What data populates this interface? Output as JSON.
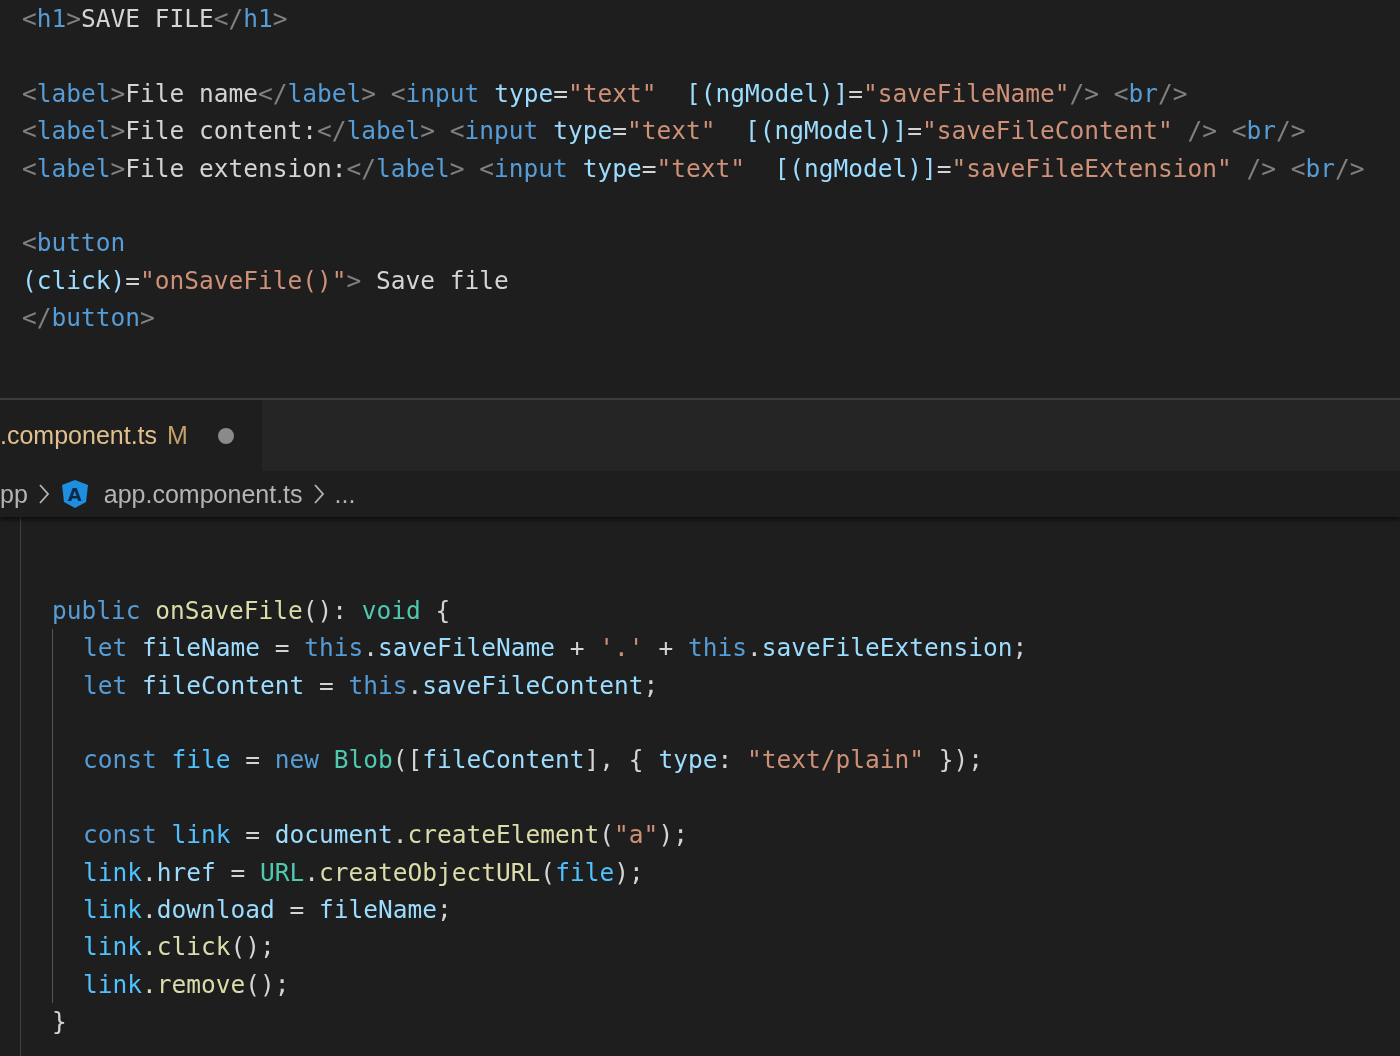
{
  "top_editor": {
    "lines": [
      {
        "kind": "code",
        "tokens": [
          {
            "kind": "bracket",
            "text": "<"
          },
          {
            "kind": "tag",
            "text": "h1"
          },
          {
            "kind": "bracket",
            "text": ">"
          },
          {
            "kind": "text",
            "text": "SAVE FILE"
          },
          {
            "kind": "bracket",
            "text": "</"
          },
          {
            "kind": "tag",
            "text": "h1"
          },
          {
            "kind": "bracket",
            "text": ">"
          }
        ]
      },
      {
        "kind": "blank"
      },
      {
        "kind": "code",
        "tokens": [
          {
            "kind": "bracket",
            "text": "<"
          },
          {
            "kind": "tag",
            "text": "label"
          },
          {
            "kind": "bracket",
            "text": ">"
          },
          {
            "kind": "text",
            "text": "File name"
          },
          {
            "kind": "bracket",
            "text": "</"
          },
          {
            "kind": "tag",
            "text": "label"
          },
          {
            "kind": "bracket",
            "text": "> <"
          },
          {
            "kind": "tag",
            "text": "input"
          },
          {
            "kind": "attr",
            "text": " type"
          },
          {
            "kind": "text",
            "text": "="
          },
          {
            "kind": "string",
            "text": "\"text\""
          },
          {
            "kind": "attr",
            "text": "  [(ngModel)]"
          },
          {
            "kind": "text",
            "text": "="
          },
          {
            "kind": "string",
            "text": "\"saveFileName\""
          },
          {
            "kind": "bracket",
            "text": "/> <"
          },
          {
            "kind": "tag",
            "text": "br"
          },
          {
            "kind": "bracket",
            "text": "/>"
          }
        ]
      },
      {
        "kind": "code",
        "tokens": [
          {
            "kind": "bracket",
            "text": "<"
          },
          {
            "kind": "tag",
            "text": "label"
          },
          {
            "kind": "bracket",
            "text": ">"
          },
          {
            "kind": "text",
            "text": "File content:"
          },
          {
            "kind": "bracket",
            "text": "</"
          },
          {
            "kind": "tag",
            "text": "label"
          },
          {
            "kind": "bracket",
            "text": "> <"
          },
          {
            "kind": "tag",
            "text": "input"
          },
          {
            "kind": "attr",
            "text": " type"
          },
          {
            "kind": "text",
            "text": "="
          },
          {
            "kind": "string",
            "text": "\"text\""
          },
          {
            "kind": "attr",
            "text": "  [(ngModel)]"
          },
          {
            "kind": "text",
            "text": "="
          },
          {
            "kind": "string",
            "text": "\"saveFileContent\""
          },
          {
            "kind": "bracket",
            "text": " /> <"
          },
          {
            "kind": "tag",
            "text": "br"
          },
          {
            "kind": "bracket",
            "text": "/>"
          }
        ]
      },
      {
        "kind": "code",
        "tokens": [
          {
            "kind": "bracket",
            "text": "<"
          },
          {
            "kind": "tag",
            "text": "label"
          },
          {
            "kind": "bracket",
            "text": ">"
          },
          {
            "kind": "text",
            "text": "File extension:"
          },
          {
            "kind": "bracket",
            "text": "</"
          },
          {
            "kind": "tag",
            "text": "label"
          },
          {
            "kind": "bracket",
            "text": "> <"
          },
          {
            "kind": "tag",
            "text": "input"
          },
          {
            "kind": "attr",
            "text": " type"
          },
          {
            "kind": "text",
            "text": "="
          },
          {
            "kind": "string",
            "text": "\"text\""
          },
          {
            "kind": "attr",
            "text": "  [(ngModel)]"
          },
          {
            "kind": "text",
            "text": "="
          },
          {
            "kind": "string",
            "text": "\"saveFileExtension\""
          },
          {
            "kind": "bracket",
            "text": " /> <"
          },
          {
            "kind": "tag",
            "text": "br"
          },
          {
            "kind": "bracket",
            "text": "/>"
          }
        ]
      },
      {
        "kind": "blank"
      },
      {
        "kind": "code",
        "tokens": [
          {
            "kind": "bracket",
            "text": "<"
          },
          {
            "kind": "tag",
            "text": "button"
          }
        ]
      },
      {
        "kind": "code",
        "tokens": [
          {
            "kind": "attr",
            "text": "(click)"
          },
          {
            "kind": "text",
            "text": "="
          },
          {
            "kind": "string",
            "text": "\"onSaveFile()\""
          },
          {
            "kind": "bracket",
            "text": ">"
          },
          {
            "kind": "text",
            "text": " Save file"
          }
        ]
      },
      {
        "kind": "code",
        "tokens": [
          {
            "kind": "bracket",
            "text": "</"
          },
          {
            "kind": "tag",
            "text": "button"
          },
          {
            "kind": "bracket",
            "text": ">"
          }
        ]
      }
    ]
  },
  "tab": {
    "label": ".component.ts",
    "status": "M",
    "unsaved": true,
    "selected": true
  },
  "breadcrumb": {
    "items": [
      {
        "kind": "folder",
        "label": "pp"
      },
      {
        "kind": "file",
        "label": "app.component.ts",
        "icon_letter": "A"
      },
      {
        "kind": "more",
        "label": "..."
      }
    ]
  },
  "bottom_editor": {
    "lines": [
      {
        "kind": "blank"
      },
      {
        "kind": "blank"
      },
      {
        "kind": "code",
        "tokens": [
          {
            "kind": "keyword",
            "text": "public"
          },
          {
            "kind": "func",
            "text": " onSaveFile"
          },
          {
            "kind": "text",
            "text": "(): "
          },
          {
            "kind": "type",
            "text": "void"
          },
          {
            "kind": "text",
            "text": " {"
          }
        ],
        "children": [
          {
            "kind": "code",
            "tokens": [
              {
                "kind": "keyword",
                "text": "let"
              },
              {
                "kind": "var",
                "text": " fileName"
              },
              {
                "kind": "text",
                "text": " = "
              },
              {
                "kind": "keyword",
                "text": "this"
              },
              {
                "kind": "text",
                "text": "."
              },
              {
                "kind": "var",
                "text": "saveFileName"
              },
              {
                "kind": "text",
                "text": " + "
              },
              {
                "kind": "string",
                "text": "'.'"
              },
              {
                "kind": "text",
                "text": " + "
              },
              {
                "kind": "keyword",
                "text": "this"
              },
              {
                "kind": "text",
                "text": "."
              },
              {
                "kind": "var",
                "text": "saveFileExtension"
              },
              {
                "kind": "text",
                "text": ";"
              }
            ]
          },
          {
            "kind": "code",
            "tokens": [
              {
                "kind": "keyword",
                "text": "let"
              },
              {
                "kind": "var",
                "text": " fileContent"
              },
              {
                "kind": "text",
                "text": " = "
              },
              {
                "kind": "keyword",
                "text": "this"
              },
              {
                "kind": "text",
                "text": "."
              },
              {
                "kind": "var",
                "text": "saveFileContent"
              },
              {
                "kind": "text",
                "text": ";"
              }
            ]
          },
          {
            "kind": "blank"
          },
          {
            "kind": "code",
            "tokens": [
              {
                "kind": "keyword",
                "text": "const"
              },
              {
                "kind": "const",
                "text": " file"
              },
              {
                "kind": "text",
                "text": " = "
              },
              {
                "kind": "keyword",
                "text": "new"
              },
              {
                "kind": "type",
                "text": " Blob"
              },
              {
                "kind": "text",
                "text": "(["
              },
              {
                "kind": "var",
                "text": "fileContent"
              },
              {
                "kind": "text",
                "text": "], { "
              },
              {
                "kind": "var",
                "text": "type"
              },
              {
                "kind": "text",
                "text": ": "
              },
              {
                "kind": "string",
                "text": "\"text/plain\""
              },
              {
                "kind": "text",
                "text": " });"
              }
            ]
          },
          {
            "kind": "blank"
          },
          {
            "kind": "code",
            "tokens": [
              {
                "kind": "keyword",
                "text": "const"
              },
              {
                "kind": "const",
                "text": " link"
              },
              {
                "kind": "text",
                "text": " = "
              },
              {
                "kind": "var",
                "text": "document"
              },
              {
                "kind": "text",
                "text": "."
              },
              {
                "kind": "func",
                "text": "createElement"
              },
              {
                "kind": "text",
                "text": "("
              },
              {
                "kind": "string",
                "text": "\"a\""
              },
              {
                "kind": "text",
                "text": ");"
              }
            ]
          },
          {
            "kind": "code",
            "tokens": [
              {
                "kind": "const",
                "text": "link"
              },
              {
                "kind": "text",
                "text": "."
              },
              {
                "kind": "var",
                "text": "href"
              },
              {
                "kind": "text",
                "text": " = "
              },
              {
                "kind": "type",
                "text": "URL"
              },
              {
                "kind": "text",
                "text": "."
              },
              {
                "kind": "func",
                "text": "createObjectURL"
              },
              {
                "kind": "text",
                "text": "("
              },
              {
                "kind": "const",
                "text": "file"
              },
              {
                "kind": "text",
                "text": ");"
              }
            ]
          },
          {
            "kind": "code",
            "tokens": [
              {
                "kind": "const",
                "text": "link"
              },
              {
                "kind": "text",
                "text": "."
              },
              {
                "kind": "var",
                "text": "download"
              },
              {
                "kind": "text",
                "text": " = "
              },
              {
                "kind": "var",
                "text": "fileName"
              },
              {
                "kind": "text",
                "text": ";"
              }
            ]
          },
          {
            "kind": "code",
            "tokens": [
              {
                "kind": "const",
                "text": "link"
              },
              {
                "kind": "func",
                "text": ".click"
              },
              {
                "kind": "text",
                "text": "();"
              }
            ]
          },
          {
            "kind": "code",
            "tokens": [
              {
                "kind": "const",
                "text": "link"
              },
              {
                "kind": "func",
                "text": ".remove"
              },
              {
                "kind": "text",
                "text": "();"
              }
            ]
          }
        ]
      },
      {
        "kind": "code",
        "tokens": [
          {
            "kind": "text",
            "text": "}"
          }
        ]
      }
    ]
  }
}
